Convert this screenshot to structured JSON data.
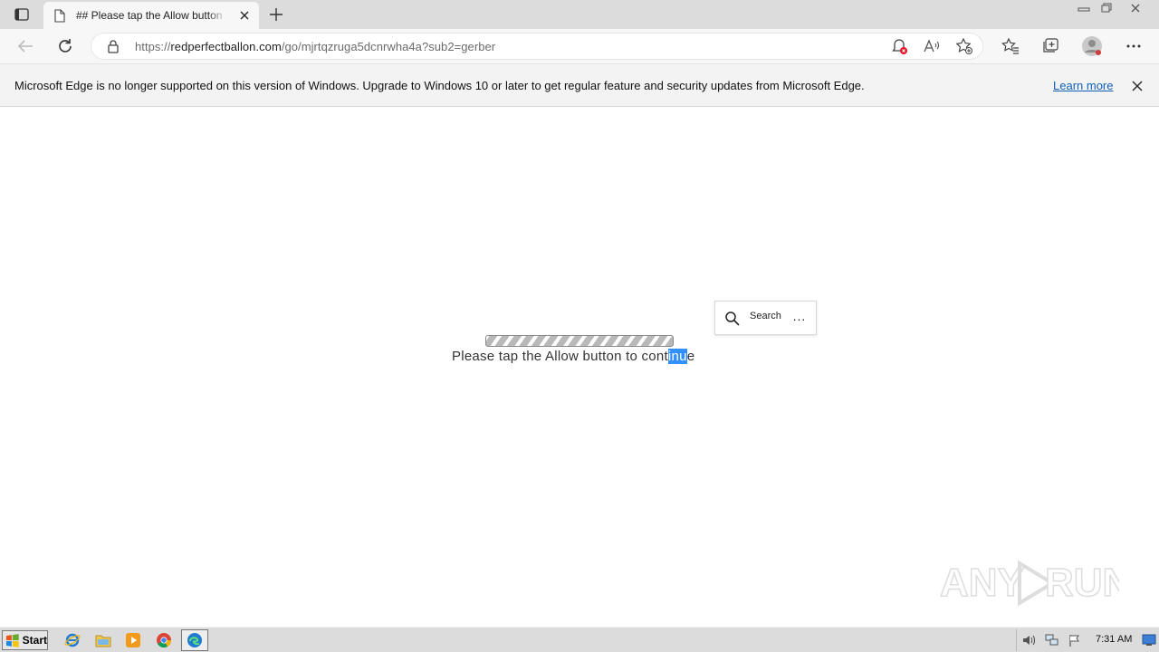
{
  "browser": {
    "tab": {
      "title": "## Please tap the Allow button to continue",
      "favicon": "page-icon"
    },
    "address": {
      "url_scheme": "https://",
      "url_host": "redperfectballon.com",
      "url_path": "/go/mjrtqzruga5dcnrwha4a?sub2=gerber"
    },
    "infobar": {
      "message": "Microsoft Edge is no longer supported on this version of Windows. Upgrade to Windows 10 or later to get regular feature and security updates from Microsoft Edge.",
      "link": "Learn more"
    }
  },
  "page": {
    "message_before": "Please tap the Allow button to cont",
    "message_selected": "inu",
    "message_after": "e",
    "mini_menu": {
      "search_label": "Search",
      "more_label": "..."
    },
    "progress": {
      "state": "indeterminate"
    }
  },
  "watermark": {
    "text_left": "ANY",
    "text_right": "RUN"
  },
  "taskbar": {
    "start_label": "Start",
    "clock": "7:31 AM"
  },
  "colors": {
    "selection": "#3390ff",
    "link": "#0f5fb8",
    "tabstrip": "#dcdcdc"
  }
}
